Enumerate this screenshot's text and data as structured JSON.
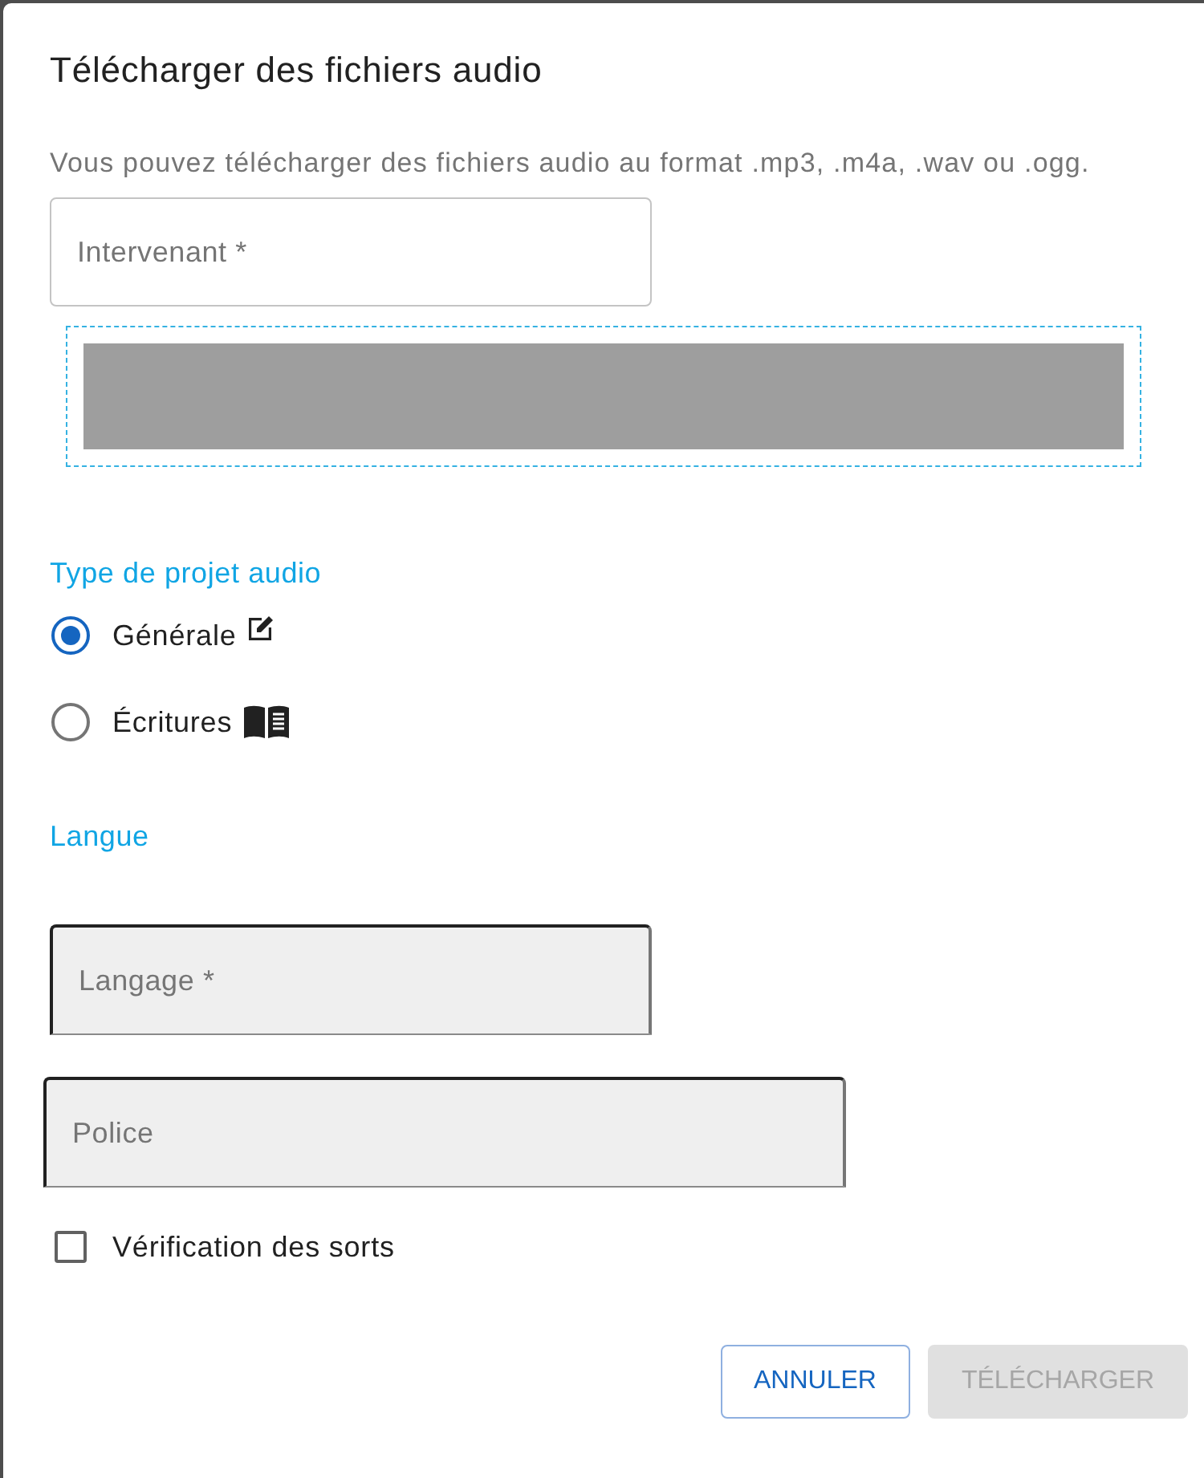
{
  "dialog": {
    "title": "Télécharger des fichiers audio",
    "description": "Vous pouvez télécharger des fichiers audio au format .mp3, .m4a, .wav ou .ogg.",
    "speaker_field": {
      "placeholder": "Intervenant *"
    },
    "project_type": {
      "label": "Type de projet audio",
      "options": [
        {
          "label": "Générale",
          "kind": "edit",
          "selected": true
        },
        {
          "label": "Écritures",
          "kind": "book",
          "selected": false
        }
      ]
    },
    "language": {
      "label": "Langue",
      "language_field": {
        "placeholder": "Langage *"
      },
      "font_field": {
        "placeholder": "Police"
      }
    },
    "spellcheck": {
      "label": "Vérification des sorts",
      "checked": false
    },
    "buttons": [
      {
        "label": "ANNULER",
        "disabled": false
      },
      {
        "label": "TÉLÉCHARGER",
        "disabled": true
      }
    ]
  }
}
